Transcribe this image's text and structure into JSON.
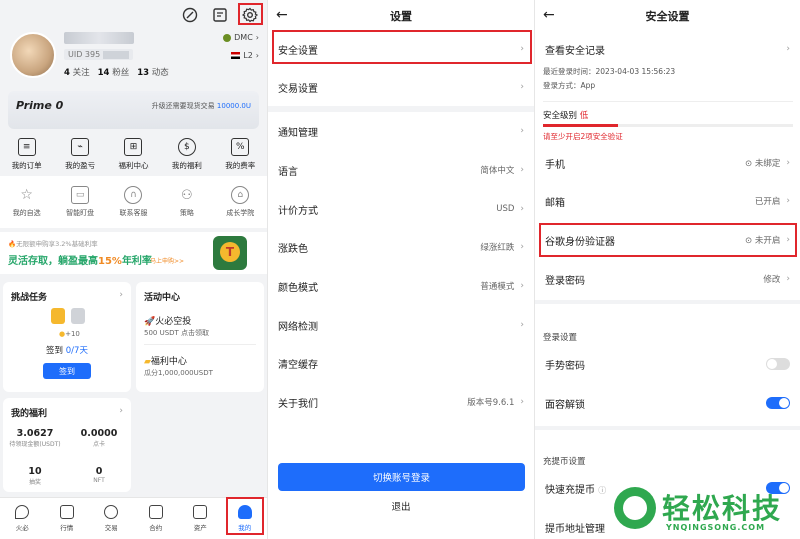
{
  "profile": {
    "uid_prefix": "UID 395",
    "following_count": "4",
    "following_label": "关注",
    "fans_count": "14",
    "fans_label": "粉丝",
    "posts_count": "13",
    "posts_label": "动态",
    "network1": "DMC",
    "network2": "L2"
  },
  "prime": {
    "title": "Prime 0",
    "upgrade_text": "升级还需要现货交易",
    "upgrade_amount": "10000.0U"
  },
  "quick_grid": [
    {
      "label": "我的订单",
      "icon": "receipt-icon"
    },
    {
      "label": "我的盈亏",
      "icon": "profit-icon"
    },
    {
      "label": "福利中心",
      "icon": "gift-icon"
    },
    {
      "label": "我的福利",
      "icon": "money-bag-icon"
    },
    {
      "label": "我的费率",
      "icon": "percent-icon"
    }
  ],
  "secondary_grid": [
    {
      "label": "我的自选",
      "icon": "star-icon"
    },
    {
      "label": "智能盯盘",
      "icon": "monitor-icon"
    },
    {
      "label": "联系客服",
      "icon": "headset-icon"
    },
    {
      "label": "策略",
      "icon": "user-icon"
    },
    {
      "label": "成长学院",
      "icon": "graduation-icon"
    }
  ],
  "banner": {
    "small": "无限额申购享3.2%基础利率",
    "main_a": "灵活存取，躺盈最高",
    "main_b": "15%",
    "main_c": "年利率",
    "cta": "马上申购>>"
  },
  "challenge": {
    "title": "挑战任务",
    "reward": "+10",
    "checkin_label": "签到",
    "checkin_progress": "0/7天",
    "button": "签到"
  },
  "activity": {
    "title": "活动中心",
    "item1_title": "火必空投",
    "item1_sub": "500 USDT 点击领取",
    "item2_title": "福利中心",
    "item2_sub": "瓜分1,000,000USDT"
  },
  "welfare": {
    "title": "我的福利",
    "v1": "3.0627",
    "l1": "待领现金额(USDT)",
    "v2": "0.0000",
    "l2": "点卡",
    "v3": "10",
    "l3": "抽奖",
    "v4": "0",
    "l4": "NFT"
  },
  "tabbar": [
    {
      "label": "火必",
      "icon": "flame-icon"
    },
    {
      "label": "行情",
      "icon": "candlestick-icon"
    },
    {
      "label": "交易",
      "icon": "exchange-icon"
    },
    {
      "label": "合约",
      "icon": "contract-icon"
    },
    {
      "label": "资产",
      "icon": "assets-icon"
    },
    {
      "label": "我的",
      "icon": "person-icon",
      "active": true
    }
  ],
  "settings": {
    "title": "设置",
    "rows": [
      {
        "label": "安全设置",
        "value": ""
      },
      {
        "label": "交易设置",
        "value": ""
      },
      {
        "label": "通知管理",
        "value": ""
      },
      {
        "label": "语言",
        "value": "简体中文"
      },
      {
        "label": "计价方式",
        "value": "USD"
      },
      {
        "label": "涨跌色",
        "value": "绿涨红跌"
      },
      {
        "label": "颜色模式",
        "value": "普通模式"
      },
      {
        "label": "网络检测",
        "value": ""
      },
      {
        "label": "清空缓存",
        "value": ""
      },
      {
        "label": "关于我们",
        "value": "版本号9.6.1"
      }
    ],
    "switch_button": "切换账号登录",
    "logout": "退出"
  },
  "security": {
    "title": "安全设置",
    "record_label": "查看安全记录",
    "last_login": "最近登录时间：2023-04-03 15:56:23",
    "login_method": "登录方式：App",
    "level_label": "安全级别",
    "level_value": "低",
    "level_tip": "请至少开启2项安全验证",
    "phone_label": "手机",
    "phone_value": "未绑定",
    "email_label": "邮箱",
    "email_value": "已开启",
    "google_label": "谷歌身份验证器",
    "google_value": "未开启",
    "pwd_label": "登录密码",
    "pwd_value": "修改",
    "login_section": "登录设置",
    "gesture_label": "手势密码",
    "gesture_on": false,
    "face_label": "面容解锁",
    "face_on": true,
    "charge_section": "充提币设置",
    "quick_label": "快速充提币",
    "quick_on": true,
    "address_label": "提币地址管理"
  },
  "watermark": {
    "cn": "轻松科技",
    "en": "YNQINGSONG.COM"
  },
  "colors": {
    "accent": "#1e6dfb",
    "danger": "#e0262c",
    "green": "#26a66a"
  }
}
